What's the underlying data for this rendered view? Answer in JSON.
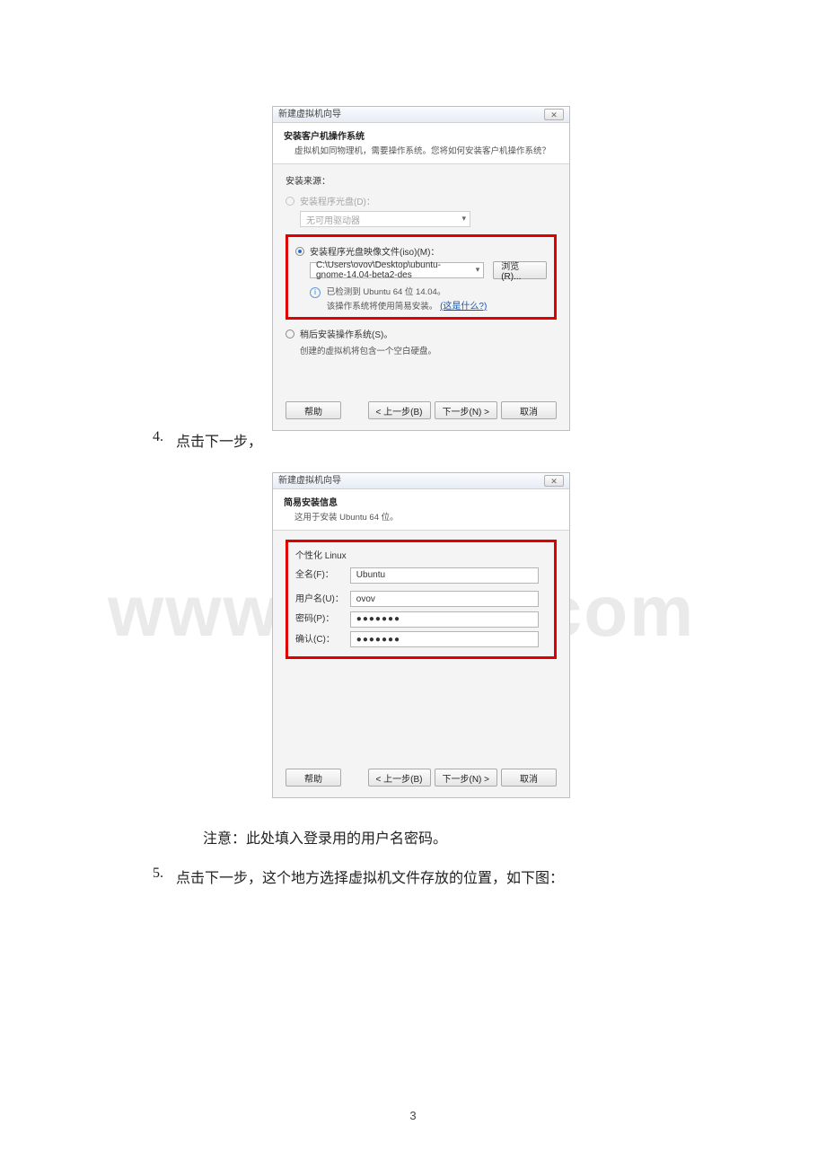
{
  "dialog1": {
    "title": "新建虚拟机向导",
    "close": "✕",
    "header_title": "安装客户机操作系统",
    "header_sub": "虚拟机如同物理机，需要操作系统。您将如何安装客户机操作系统？",
    "source_label": "安装来源：",
    "radio_disc": "安装程序光盘(D)：",
    "disc_combo": "无可用驱动器",
    "radio_iso": "安装程序光盘映像文件(iso)(M)：",
    "iso_path": "C:\\Users\\ovov\\Desktop\\ubuntu-gnome-14.04-beta2-des",
    "browse_btn": "浏览(R)...",
    "detected": "已检测到 Ubuntu 64 位 14.04。",
    "detected_sub_pre": "该操作系统将使用简易安装。",
    "detected_link": "(这是什么?)",
    "radio_later": "稍后安装操作系统(S)。",
    "later_note": "创建的虚拟机将包含一个空白硬盘。",
    "btn_help": "帮助",
    "btn_back": "< 上一步(B)",
    "btn_next": "下一步(N) >",
    "btn_cancel": "取消"
  },
  "dialog2": {
    "title": "新建虚拟机向导",
    "close": "✕",
    "header_title": "简易安装信息",
    "header_sub": "这用于安装 Ubuntu 64 位。",
    "section": "个性化 Linux",
    "label_fullname": "全名(F)：",
    "val_fullname": "Ubuntu",
    "label_user": "用户名(U)：",
    "val_user": "ovov",
    "label_pass": "密码(P)：",
    "val_pass": "●●●●●●●",
    "label_confirm": "确认(C)：",
    "val_confirm": "●●●●●●●",
    "btn_help": "帮助",
    "btn_back": "< 上一步(B)",
    "btn_next": "下一步(N) >",
    "btn_cancel": "取消"
  },
  "doc": {
    "step4_no": "4.",
    "step4": "点击下一步，",
    "note": "注意：此处填入登录用的用户名密码。",
    "step5_no": "5.",
    "step5": "点击下一步，这个地方选择虚拟机文件存放的位置，如下图：",
    "pagenum": "3",
    "watermark": "www.bdocx.com"
  }
}
